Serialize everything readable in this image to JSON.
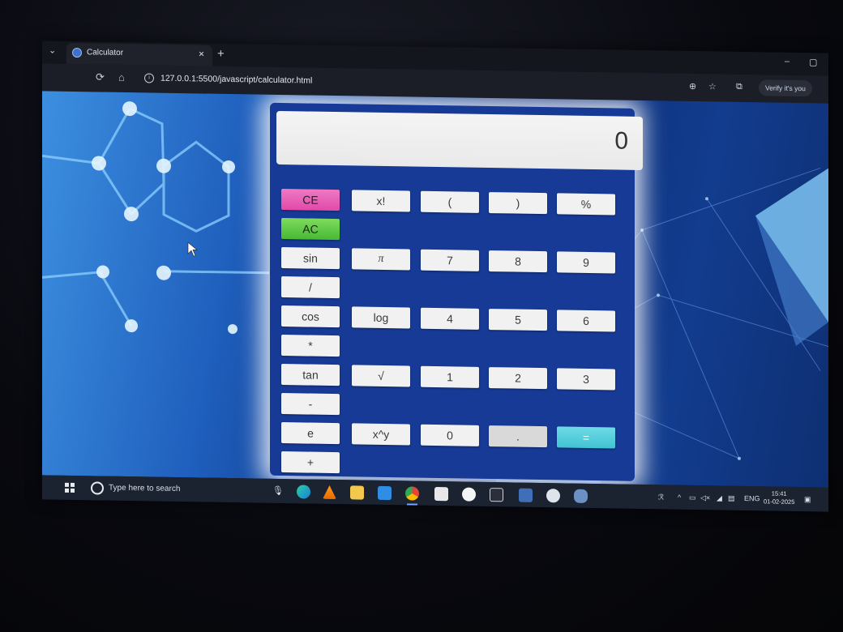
{
  "browser": {
    "tab_title": "Calculator",
    "tab_close": "×",
    "new_tab": "+",
    "address": "127.0.0.1:5500/javascript/calculator.html",
    "verify_label": "Verify it's you",
    "window_controls": [
      "–",
      "▢",
      "✕"
    ]
  },
  "calculator": {
    "display": "0",
    "buttons": {
      "ce": "CE",
      "ac": "AC",
      "fact": "x!",
      "lparen": "(",
      "rparen": ")",
      "percent": "%",
      "sin": "sin",
      "pi": "π",
      "seven": "7",
      "eight": "8",
      "nine": "9",
      "divide": "/",
      "cos": "cos",
      "log": "log",
      "four": "4",
      "five": "5",
      "six": "6",
      "multiply": "*",
      "tan": "tan",
      "sqrt": "√",
      "one": "1",
      "two": "2",
      "three": "3",
      "minus": "-",
      "e": "e",
      "pow": "x^y",
      "zero": "0",
      "dot": ".",
      "equals": "=",
      "plus": "+"
    },
    "colors": {
      "ce": "#e04aa8",
      "ac": "#47b935",
      "equals": "#41c3d3"
    }
  },
  "taskbar": {
    "search_placeholder": "Type here to search",
    "language": "ENG",
    "time": "15:41",
    "date": "01-02-2025",
    "apps": [
      "edge-icon",
      "vlc-icon",
      "file-explorer-icon",
      "vscode-icon",
      "chrome-icon",
      "store-icon",
      "github-icon",
      "terminal-icon",
      "paint-icon",
      "app-icon",
      "postgres-icon"
    ]
  }
}
